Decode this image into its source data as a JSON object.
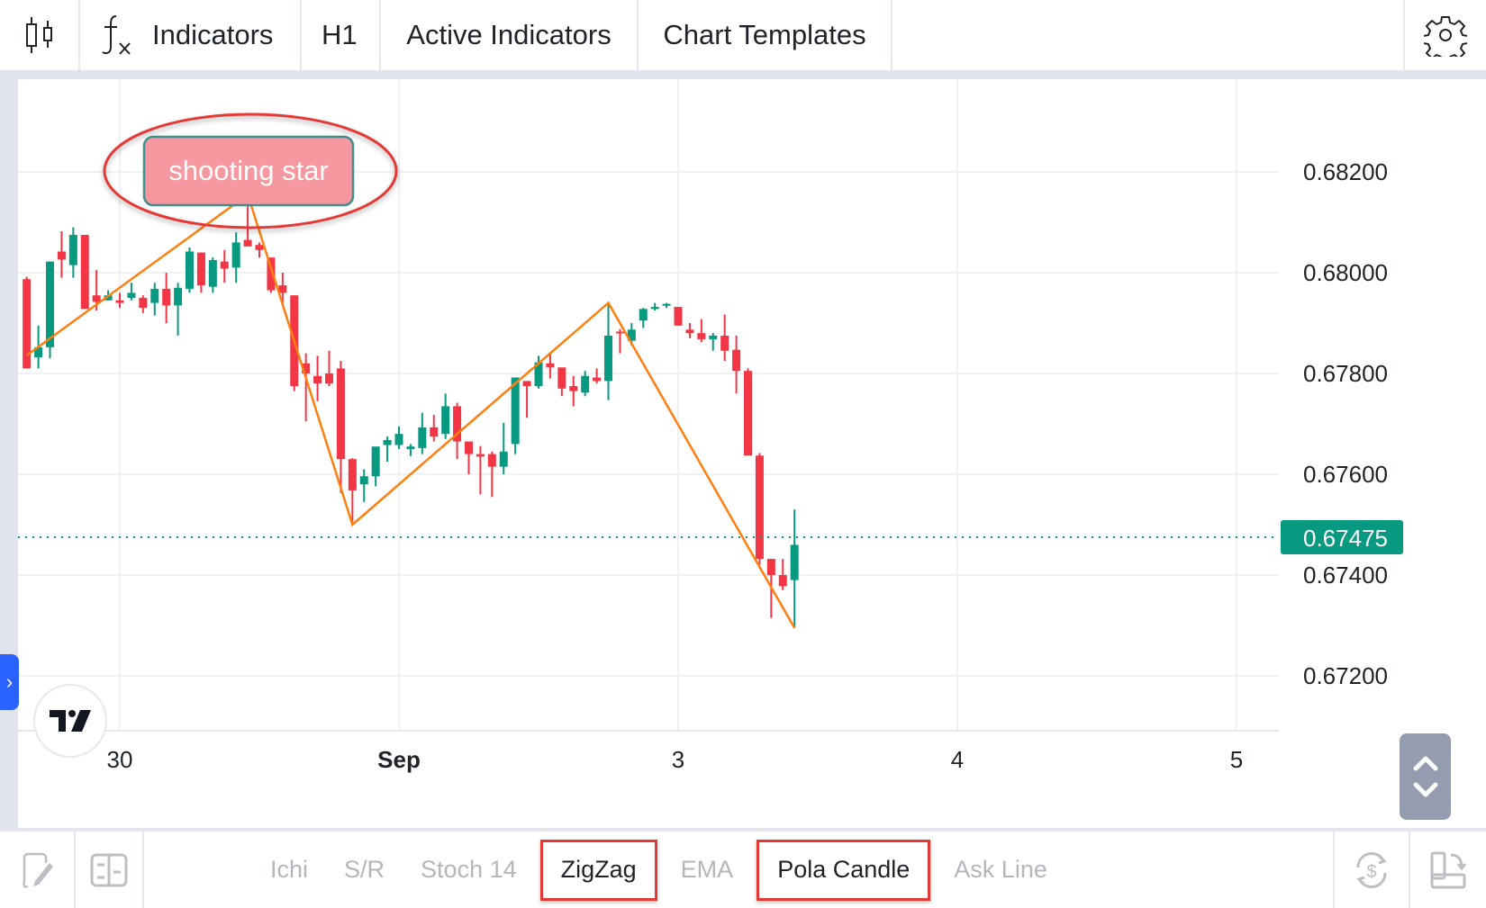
{
  "toolbar": {
    "chart_type_icon": "candlestick-icon",
    "indicators_label": "Indicators",
    "indicators_icon_text": "f",
    "timeframe": "H1",
    "active_indicators_label": "Active Indicators",
    "chart_templates_label": "Chart Templates",
    "settings_icon": "gear-icon"
  },
  "annotation": {
    "label": "shooting star"
  },
  "price_scale": {
    "current_price": "0.67475"
  },
  "colors": {
    "up": "#089981",
    "down": "#f23645",
    "zigzag": "#ff7f0e",
    "annotation_fill": "#f5989f",
    "annotation_border": "#3f8f8a",
    "ellipse": "#e53935"
  },
  "chart_data": {
    "type": "candlestick",
    "title": "",
    "timeframe": "H1",
    "y_ticks": [
      "0.68200",
      "0.68000",
      "0.67800",
      "0.67600",
      "0.67400",
      "0.67200"
    ],
    "y_tick_values": [
      0.682,
      0.68,
      0.678,
      0.676,
      0.674,
      0.672
    ],
    "ylim": [
      0.6707,
      0.6856
    ],
    "x_ticks": [
      {
        "label": "30",
        "index": 8,
        "bold": false
      },
      {
        "label": "Sep",
        "index": 32,
        "bold": true
      },
      {
        "label": "3",
        "index": 56,
        "bold": false
      },
      {
        "label": "4",
        "index": 80,
        "bold": false
      },
      {
        "label": "5",
        "index": 104,
        "bold": false
      }
    ],
    "grid": true,
    "last_price": 0.67475,
    "candles": [
      {
        "o": 0.67987,
        "h": 0.67992,
        "l": 0.6781,
        "c": 0.6781
      },
      {
        "o": 0.67832,
        "h": 0.67895,
        "l": 0.6781,
        "c": 0.67852
      },
      {
        "o": 0.67852,
        "h": 0.68022,
        "l": 0.6783,
        "c": 0.68022
      },
      {
        "o": 0.68042,
        "h": 0.68082,
        "l": 0.6799,
        "c": 0.68026
      },
      {
        "o": 0.68015,
        "h": 0.6809,
        "l": 0.6799,
        "c": 0.68075
      },
      {
        "o": 0.68075,
        "h": 0.68075,
        "l": 0.67935,
        "c": 0.67928
      },
      {
        "o": 0.67955,
        "h": 0.68005,
        "l": 0.67925,
        "c": 0.67942
      },
      {
        "o": 0.67945,
        "h": 0.67965,
        "l": 0.67945,
        "c": 0.67955
      },
      {
        "o": 0.67945,
        "h": 0.6796,
        "l": 0.6793,
        "c": 0.6794
      },
      {
        "o": 0.6795,
        "h": 0.6798,
        "l": 0.67945,
        "c": 0.6796
      },
      {
        "o": 0.6795,
        "h": 0.67955,
        "l": 0.6792,
        "c": 0.6793
      },
      {
        "o": 0.6794,
        "h": 0.6798,
        "l": 0.67915,
        "c": 0.67968
      },
      {
        "o": 0.67968,
        "h": 0.68,
        "l": 0.679,
        "c": 0.67935
      },
      {
        "o": 0.67935,
        "h": 0.6798,
        "l": 0.67875,
        "c": 0.6797
      },
      {
        "o": 0.67968,
        "h": 0.6805,
        "l": 0.6796,
        "c": 0.68042
      },
      {
        "o": 0.6804,
        "h": 0.6804,
        "l": 0.6796,
        "c": 0.67975
      },
      {
        "o": 0.67972,
        "h": 0.6803,
        "l": 0.6796,
        "c": 0.68025
      },
      {
        "o": 0.68022,
        "h": 0.68045,
        "l": 0.6798,
        "c": 0.68008
      },
      {
        "o": 0.6801,
        "h": 0.6808,
        "l": 0.6798,
        "c": 0.6806
      },
      {
        "o": 0.68065,
        "h": 0.68155,
        "l": 0.68055,
        "c": 0.68052
      },
      {
        "o": 0.68055,
        "h": 0.6806,
        "l": 0.6803,
        "c": 0.68045
      },
      {
        "o": 0.6803,
        "h": 0.6803,
        "l": 0.6796,
        "c": 0.67965
      },
      {
        "o": 0.67975,
        "h": 0.68,
        "l": 0.6794,
        "c": 0.6796
      },
      {
        "o": 0.67955,
        "h": 0.67955,
        "l": 0.67765,
        "c": 0.67775
      },
      {
        "o": 0.6782,
        "h": 0.6784,
        "l": 0.67705,
        "c": 0.678
      },
      {
        "o": 0.67795,
        "h": 0.67835,
        "l": 0.67745,
        "c": 0.6778
      },
      {
        "o": 0.678,
        "h": 0.67845,
        "l": 0.67775,
        "c": 0.6778
      },
      {
        "o": 0.6781,
        "h": 0.67825,
        "l": 0.67563,
        "c": 0.6763
      },
      {
        "o": 0.6763,
        "h": 0.67632,
        "l": 0.675,
        "c": 0.67568
      },
      {
        "o": 0.6758,
        "h": 0.6761,
        "l": 0.67545,
        "c": 0.67596
      },
      {
        "o": 0.67596,
        "h": 0.6765,
        "l": 0.67576,
        "c": 0.67655
      },
      {
        "o": 0.67658,
        "h": 0.67675,
        "l": 0.67625,
        "c": 0.67668
      },
      {
        "o": 0.67658,
        "h": 0.67695,
        "l": 0.6765,
        "c": 0.6768
      },
      {
        "o": 0.6765,
        "h": 0.6766,
        "l": 0.67636,
        "c": 0.67655
      },
      {
        "o": 0.67652,
        "h": 0.67722,
        "l": 0.6764,
        "c": 0.67693
      },
      {
        "o": 0.67693,
        "h": 0.67718,
        "l": 0.67665,
        "c": 0.67675
      },
      {
        "o": 0.6768,
        "h": 0.6776,
        "l": 0.6767,
        "c": 0.67735
      },
      {
        "o": 0.67735,
        "h": 0.67742,
        "l": 0.6763,
        "c": 0.67665
      },
      {
        "o": 0.67665,
        "h": 0.67665,
        "l": 0.676,
        "c": 0.6764
      },
      {
        "o": 0.6764,
        "h": 0.67656,
        "l": 0.6756,
        "c": 0.67635
      },
      {
        "o": 0.6764,
        "h": 0.67645,
        "l": 0.67555,
        "c": 0.67615
      },
      {
        "o": 0.67615,
        "h": 0.67702,
        "l": 0.676,
        "c": 0.67645
      },
      {
        "o": 0.6766,
        "h": 0.67782,
        "l": 0.6764,
        "c": 0.67792
      },
      {
        "o": 0.67785,
        "h": 0.67785,
        "l": 0.67712,
        "c": 0.67775
      },
      {
        "o": 0.67775,
        "h": 0.67835,
        "l": 0.6777,
        "c": 0.67822
      },
      {
        "o": 0.6782,
        "h": 0.6784,
        "l": 0.6779,
        "c": 0.67812
      },
      {
        "o": 0.67812,
        "h": 0.67812,
        "l": 0.67755,
        "c": 0.6777
      },
      {
        "o": 0.67775,
        "h": 0.67795,
        "l": 0.67735,
        "c": 0.67765
      },
      {
        "o": 0.67762,
        "h": 0.67805,
        "l": 0.67755,
        "c": 0.67795
      },
      {
        "o": 0.67792,
        "h": 0.6781,
        "l": 0.6778,
        "c": 0.67785
      },
      {
        "o": 0.67785,
        "h": 0.67938,
        "l": 0.67747,
        "c": 0.67875
      },
      {
        "o": 0.67883,
        "h": 0.67888,
        "l": 0.6784,
        "c": 0.6788
      },
      {
        "o": 0.67865,
        "h": 0.679,
        "l": 0.67855,
        "c": 0.67887
      },
      {
        "o": 0.67905,
        "h": 0.6793,
        "l": 0.6789,
        "c": 0.67928
      },
      {
        "o": 0.67928,
        "h": 0.6794,
        "l": 0.67925,
        "c": 0.67932
      },
      {
        "o": 0.67935,
        "h": 0.6794,
        "l": 0.6793,
        "c": 0.67938
      },
      {
        "o": 0.67932,
        "h": 0.67932,
        "l": 0.67895,
        "c": 0.67895
      },
      {
        "o": 0.67887,
        "h": 0.679,
        "l": 0.6787,
        "c": 0.6788
      },
      {
        "o": 0.6788,
        "h": 0.67908,
        "l": 0.67862,
        "c": 0.67868
      },
      {
        "o": 0.67868,
        "h": 0.6788,
        "l": 0.67845,
        "c": 0.67875
      },
      {
        "o": 0.67875,
        "h": 0.67917,
        "l": 0.67825,
        "c": 0.67845
      },
      {
        "o": 0.67847,
        "h": 0.67875,
        "l": 0.6776,
        "c": 0.67805
      },
      {
        "o": 0.67805,
        "h": 0.6781,
        "l": 0.6764,
        "c": 0.67637
      },
      {
        "o": 0.67637,
        "h": 0.67642,
        "l": 0.6742,
        "c": 0.67432
      },
      {
        "o": 0.67432,
        "h": 0.67432,
        "l": 0.67315,
        "c": 0.674
      },
      {
        "o": 0.674,
        "h": 0.67432,
        "l": 0.6737,
        "c": 0.67378
      },
      {
        "o": 0.6739,
        "h": 0.6753,
        "l": 0.67295,
        "c": 0.6746
      }
    ],
    "indicators": {
      "zigzag": {
        "points": [
          {
            "index": 0,
            "price": 0.67836
          },
          {
            "index": 19,
            "price": 0.68155
          },
          {
            "index": 28,
            "price": 0.675
          },
          {
            "index": 50,
            "price": 0.6794
          },
          {
            "index": 66,
            "price": 0.67295
          }
        ]
      }
    },
    "annotations": [
      {
        "type": "callout",
        "text": "shooting star",
        "candle_index": 19,
        "highlighted_by": "ellipse"
      }
    ]
  },
  "axes_labels": {
    "x": [
      "30",
      "Sep",
      "3",
      "4",
      "5"
    ],
    "y": [
      "0.68200",
      "0.68000",
      "0.67800",
      "0.67600",
      "0.67400",
      "0.67200"
    ]
  },
  "bottom_bar": {
    "drawing_icon": "pen-drawing-icon",
    "layout_icon": "layout-panel-icon",
    "tabs": [
      {
        "label": "Ichi",
        "active": false
      },
      {
        "label": "S/R",
        "active": false
      },
      {
        "label": "Stoch 14",
        "active": false
      },
      {
        "label": "ZigZag",
        "active": true
      },
      {
        "label": "EMA",
        "active": false
      },
      {
        "label": "Pola Candle",
        "active": true
      },
      {
        "label": "Ask Line",
        "active": false
      }
    ],
    "currency_icon": "currency-refresh-icon",
    "rotate_icon": "rotate-device-icon"
  },
  "side_toggle_label": "›"
}
